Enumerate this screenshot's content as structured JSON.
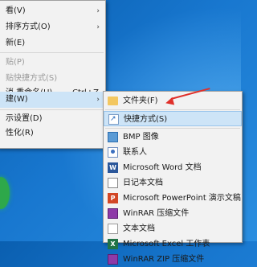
{
  "context_menu": {
    "items": [
      {
        "label": "看(V)",
        "arrow": "›",
        "disabled": false
      },
      {
        "label": "排序方式(O)",
        "arrow": "›",
        "disabled": false
      },
      {
        "label": "新(E)",
        "arrow": "",
        "disabled": false
      },
      {
        "label": "贴(P)",
        "arrow": "",
        "disabled": true
      },
      {
        "label": "贴快捷方式(S)",
        "arrow": "",
        "disabled": true
      },
      {
        "label": "消 重命名(U)",
        "shortcut": "Ctrl+Z",
        "arrow": "",
        "disabled": false
      },
      {
        "label": "建(W)",
        "arrow": "›",
        "disabled": false,
        "highlighted": true
      },
      {
        "label": "示设置(D)",
        "arrow": "",
        "disabled": false
      },
      {
        "label": "性化(R)",
        "arrow": "",
        "disabled": false
      }
    ]
  },
  "new_submenu": {
    "items": [
      {
        "label": "文件夹(F)",
        "icon": "folder-icon"
      },
      {
        "label": "快捷方式(S)",
        "icon": "shortcut-icon",
        "highlighted": true
      },
      {
        "label": "BMP 图像",
        "icon": "bmp-image-icon"
      },
      {
        "label": "联系人",
        "icon": "contact-icon"
      },
      {
        "label": "Microsoft Word 文档",
        "icon": "word-icon"
      },
      {
        "label": "日记本文档",
        "icon": "journal-icon"
      },
      {
        "label": "Microsoft PowerPoint 演示文稿",
        "icon": "powerpoint-icon"
      },
      {
        "label": "WinRAR 压缩文件",
        "icon": "winrar-icon"
      },
      {
        "label": "文本文档",
        "icon": "text-document-icon"
      },
      {
        "label": "Microsoft Excel 工作表",
        "icon": "excel-icon"
      },
      {
        "label": "WinRAR ZIP 压缩文件",
        "icon": "winrar-zip-icon"
      }
    ]
  },
  "colors": {
    "menu_bg": "#f2f2f2",
    "highlight": "#cde4f7",
    "annotation_arrow": "#e0302a",
    "desktop": "#1877cf"
  }
}
